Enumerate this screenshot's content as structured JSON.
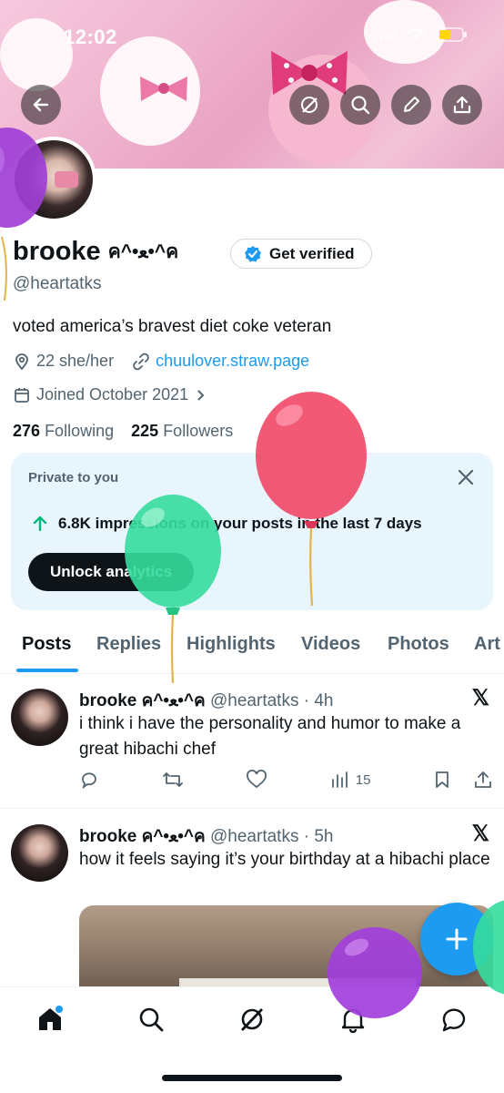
{
  "status_bar": {
    "time": "12:02"
  },
  "profile": {
    "name": "brooke",
    "name_decoration": "ค^•ﻌ•^ค",
    "get_verified_label": "Get verified",
    "handle": "@heartatks",
    "bio": "voted america’s bravest diet coke veteran",
    "location": "22 she/her",
    "website": "chuulover.straw.page",
    "joined": "Joined October 2021",
    "following_count": "276",
    "following_label": "Following",
    "followers_count": "225",
    "followers_label": "Followers"
  },
  "private_card": {
    "title": "Private to you",
    "impressions_text": "6.8K impressions on your posts in the last 7 days",
    "unlock_label": "Unlock analytics"
  },
  "tabs": [
    "Posts",
    "Replies",
    "Highlights",
    "Videos",
    "Photos",
    "Art"
  ],
  "posts": [
    {
      "name": "brooke ค^•ﻌ•^ค",
      "handle": "@heartatks",
      "time": "· 4h",
      "text": "i think i have the personality and humor to make a great hibachi chef",
      "views": "15"
    },
    {
      "name": "brooke ค^•ﻌ•^ค",
      "handle": "@heartatks",
      "time": "· 5h",
      "text": "how it feels saying it’s your birthday at a hibachi place"
    }
  ],
  "icons": {
    "back": "back-arrow-icon",
    "grok": "grok-icon",
    "search": "search-icon",
    "edit": "pencil-icon",
    "share": "share-icon",
    "x_logo": "x-logo-icon"
  },
  "colors": {
    "accent": "#1d9bf0",
    "text": "#0f1419",
    "muted": "#536471"
  }
}
